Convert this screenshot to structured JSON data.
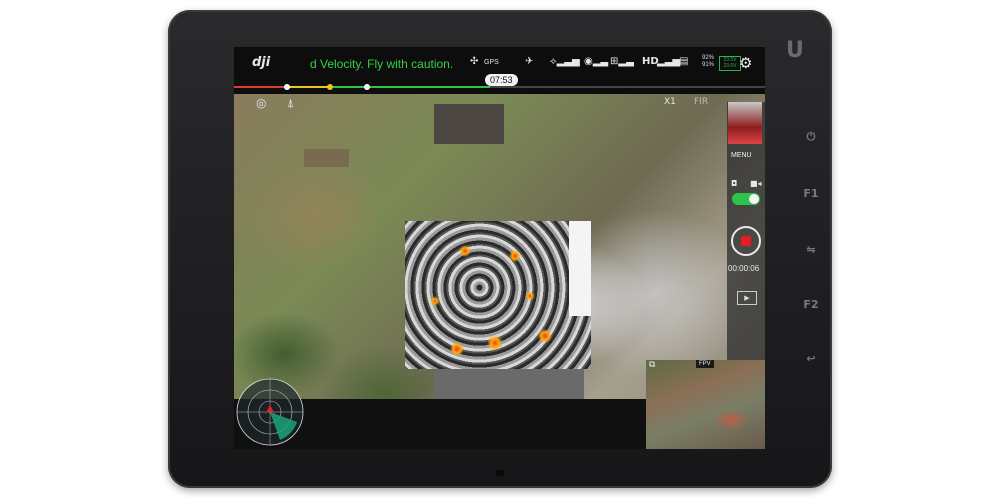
{
  "device": {
    "brand_mark": "U",
    "buttons": [
      "⏻",
      "F1",
      "⇋",
      "F2",
      "↩"
    ]
  },
  "topbar": {
    "logo": "dji",
    "message": "d Velocity. Fly with caution.",
    "gps_label": "GPS",
    "hd_label": "HD",
    "flight_time": "07:53",
    "battery_pct_top": "92%",
    "battery_pct_bottom": "91%",
    "battery_voltage_top": "23.5V",
    "battery_voltage_bottom": "23.6V"
  },
  "overlay": {
    "zoom": "X1",
    "mode": "FIR"
  },
  "right_panel": {
    "menu_label": "MENU",
    "record_time": "00:00:06"
  },
  "pip": {
    "label": "FPV"
  },
  "colors": {
    "message_green": "#35d04a",
    "record_red": "#e51c23",
    "toggle_green": "#2ec34a"
  },
  "icons": [
    "drone-icon",
    "takeoff-icon",
    "rc-signal-icon",
    "wifi-icon",
    "controller-icon",
    "gear-icon",
    "camera-icon",
    "video-icon",
    "playback-icon",
    "radar-icon"
  ]
}
